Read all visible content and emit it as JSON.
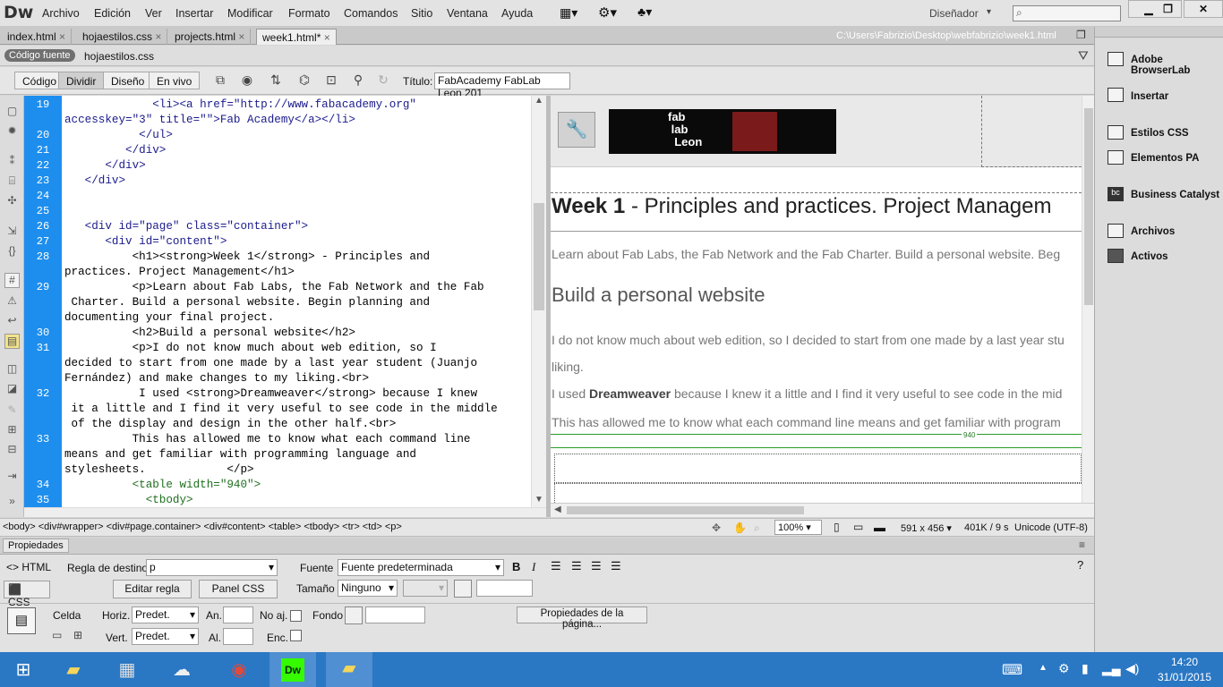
{
  "menubar": {
    "logo": "Dw",
    "items": [
      "Archivo",
      "Edición",
      "Ver",
      "Insertar",
      "Modificar",
      "Formato",
      "Comandos",
      "Sitio",
      "Ventana",
      "Ayuda"
    ],
    "workspace": "Diseñador",
    "search_placeholder": ""
  },
  "tabs": [
    "index.html",
    "hojaestilos.css",
    "projects.html",
    "week1.html*"
  ],
  "filepath": "C:\\Users\\Fabrizio\\Desktop\\webfabrizio\\week1.html",
  "related": {
    "source": "Código fuente",
    "file": "hojaestilos.css"
  },
  "docbar": {
    "views": [
      "Código",
      "Dividir",
      "Diseño",
      "En vivo"
    ],
    "title_label": "Título:",
    "title_value": "FabAcademy FabLab Leon 201"
  },
  "gutter": [
    "19",
    "20",
    "21",
    "22",
    "23",
    "24",
    "25",
    "26",
    "27",
    "28",
    "29",
    "30",
    "31",
    "32",
    "33",
    "34",
    "35"
  ],
  "code_lines": [
    "             <li><a href=\"http://www.fabacademy.org\"",
    "accesskey=\"3\" title=\"\">Fab Academy</a></li>",
    "           </ul>",
    "         </div>",
    "      </div>",
    "   </div>",
    "",
    "",
    "   <div id=\"page\" class=\"container\">",
    "      <div id=\"content\">",
    "          <h1><strong>Week 1</strong> - Principles and",
    "practices. Project Management</h1>",
    "          <p>Learn about Fab Labs, the Fab Network and the Fab",
    " Charter. Build a personal website. Begin planning and",
    "documenting your final project.",
    "          <h2>Build a personal website</h2>",
    "          <p>I do not know much about web edition, so I",
    "decided to start from one made by a last year student (Juanjo",
    "Fernández) and make changes to my liking.<br>",
    "           I used <strong>Dreamweaver</strong> because I knew",
    " it a little and I find it very useful to see code in the middle",
    " of the display and design in the other half.<br>",
    "          This has allowed me to know what each command line",
    "means and get familiar with programming language and",
    "stylesheets.            </p>",
    "          <table width=\"940\">",
    "            <tbody>"
  ],
  "design": {
    "h1_bold": "Week 1",
    "h1_rest": " - Principles and practices. Project Managem",
    "p1": "Learn about Fab Labs, the Fab Network and the Fab Charter. Build a personal website. Beg",
    "h2": "Build a personal website",
    "p2": "I do not know much about web edition, so I decided to start from one made by a last year stu",
    "p2b": "liking.",
    "p3_pre": "I used ",
    "p3_bold": "Dreamweaver",
    "p3_post": " because I knew it a little and I find it very useful to see code in the mid",
    "p4": "This has allowed me to know what each command line means and get familiar with program",
    "table_width": "940"
  },
  "tagselector": "<body> <div#wrapper> <div#page.container> <div#content> <table> <tbody> <tr> <td> <p>",
  "statusbar": {
    "zoom": "100%",
    "size": "591 x 456",
    "weight": "401K / 9 s",
    "encoding": "Unicode (UTF-8)"
  },
  "props": {
    "title": "Propiedades",
    "html": "HTML",
    "css": "CSS",
    "regla_label": "Regla de destino",
    "regla_value": "p",
    "editar": "Editar regla",
    "panel_css": "Panel CSS",
    "fuente_label": "Fuente",
    "fuente_value": "Fuente predeterminada",
    "tamano_label": "Tamaño",
    "tamano_value": "Ninguno",
    "celda": "Celda",
    "horiz": "Horiz.",
    "horiz_value": "Predet.",
    "vert": "Vert.",
    "vert_value": "Predet.",
    "an": "An.",
    "al": "Al.",
    "noaj": "No aj.",
    "enc": "Enc.",
    "fondo": "Fondo",
    "page_props": "Propiedades de la página..."
  },
  "panel": [
    "Adobe BrowserLab",
    "Insertar",
    "Estilos CSS",
    "Elementos PA",
    "Business Catalyst",
    "Archivos",
    "Activos"
  ],
  "clock": {
    "time": "14:20",
    "date": "31/01/2015"
  }
}
